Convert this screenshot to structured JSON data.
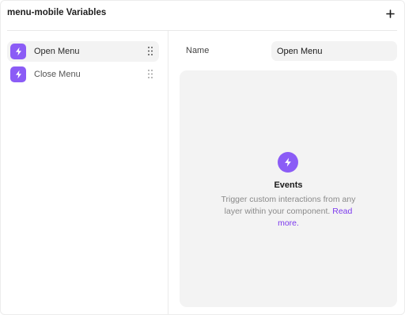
{
  "header": {
    "title": "menu-mobile Variables",
    "add_icon": "plus-icon"
  },
  "variables": {
    "items": [
      {
        "label": "Open Menu",
        "icon": "lightning-bolt-icon",
        "selected": true
      },
      {
        "label": "Close Menu",
        "icon": "lightning-bolt-icon",
        "selected": false
      }
    ],
    "drag_icon": "drag-handle-icon"
  },
  "detail": {
    "name_label": "Name",
    "name_value": "Open Menu"
  },
  "events": {
    "title": "Events",
    "description": "Trigger custom interactions from any layer within your component.",
    "link_text": "Read more."
  },
  "colors": {
    "accent": "#8b5cf6",
    "link": "#7c3aed",
    "surface": "#f3f3f3"
  }
}
